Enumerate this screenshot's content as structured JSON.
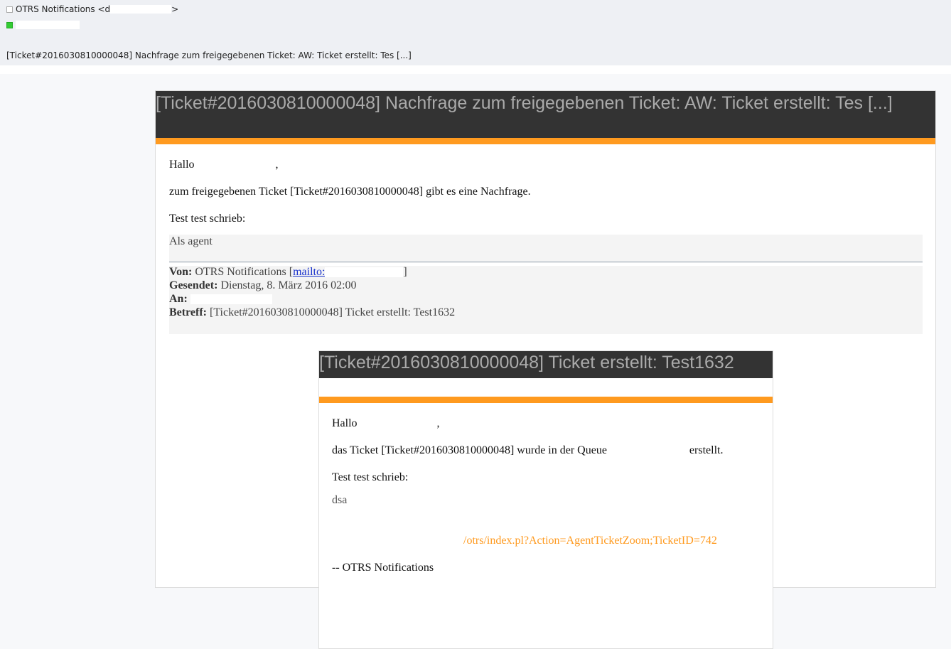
{
  "header": {
    "from_name": "OTRS Notifications <d",
    "from_suffix": ">",
    "subject": "[Ticket#2016030810000048] Nachfrage zum freigegebenen Ticket: AW: Ticket erstellt: Tes [...]"
  },
  "email": {
    "banner_title": "[Ticket#2016030810000048] Nachfrage zum freigegebenen Ticket: AW: Ticket erstellt: Tes [...]",
    "greeting": "Hallo",
    "greeting_suffix": ",",
    "line1": "zum freigegebenen Ticket [Ticket#2016030810000048] gibt es eine Nachfrage.",
    "line2": "Test test schrieb:",
    "quote": "Als agent",
    "meta": {
      "from_label": "Von:",
      "from_value": "OTRS Notifications [",
      "from_link": "mailto:",
      "from_end": "]",
      "sent_label": "Gesendet:",
      "sent_value": "Dienstag, 8. März 2016 02:00",
      "to_label": "An:",
      "subject_label": "Betreff:",
      "subject_value": "[Ticket#2016030810000048] Ticket erstellt: Test1632"
    },
    "inner": {
      "banner_title": "[Ticket#2016030810000048] Ticket erstellt: Test1632",
      "greeting": "Hallo",
      "greeting_suffix": ",",
      "line1_a": "das Ticket [Ticket#2016030810000048] wurde in der Queue",
      "line1_b": "erstellt.",
      "line2": "Test test schrieb:",
      "body": "dsa",
      "link_text": "/otrs/index.pl?Action=AgentTicketZoom;TicketID=742",
      "signature": "-- OTRS Notifications"
    }
  },
  "colors": {
    "accent": "#ff9a1f",
    "banner": "#333333",
    "banner_text": "#aaaaaa"
  }
}
